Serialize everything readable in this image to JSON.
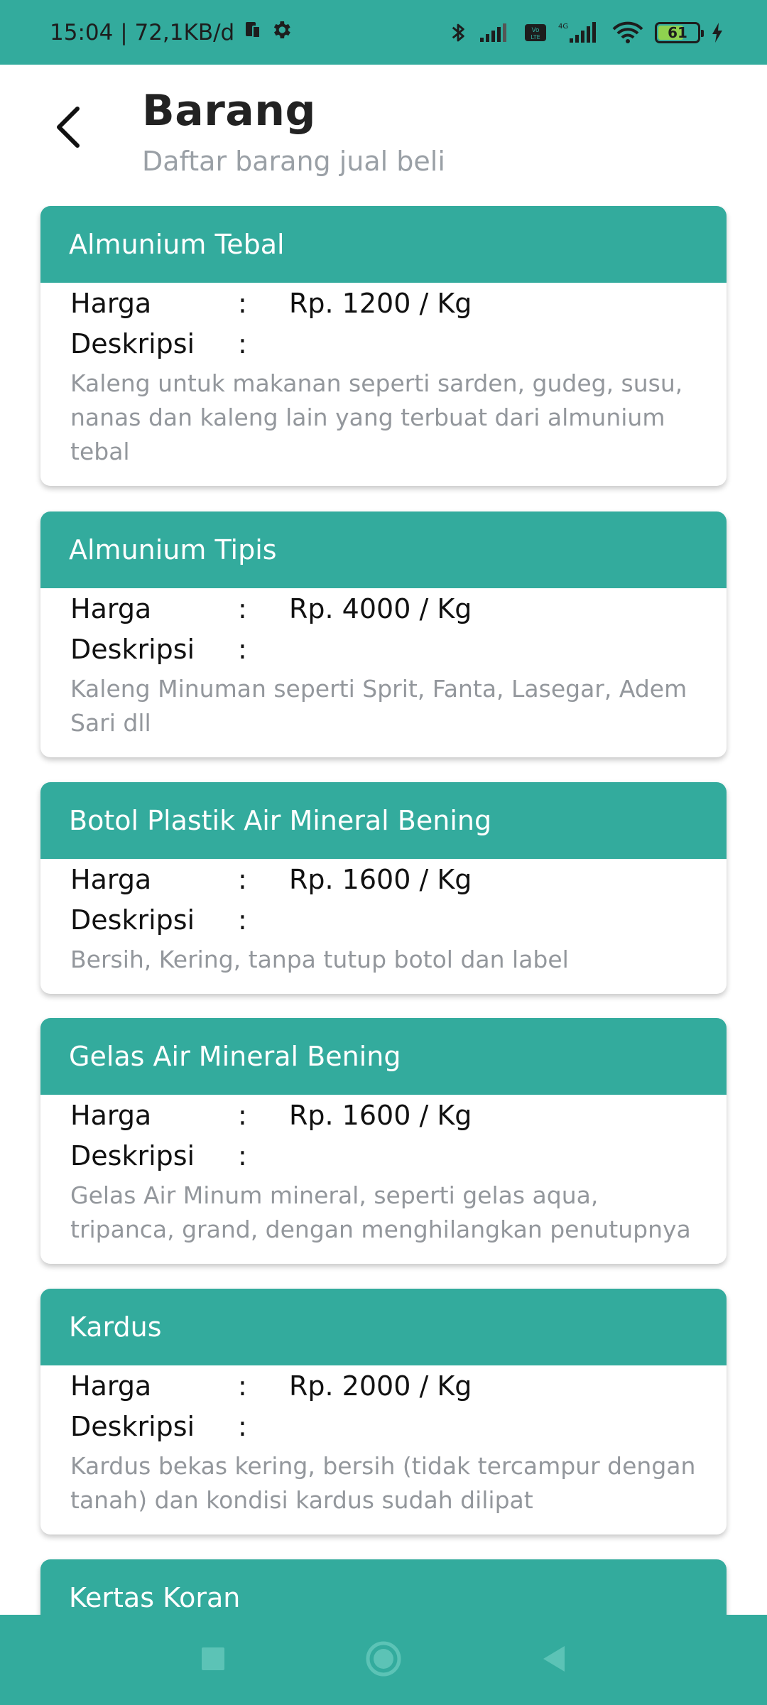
{
  "status_bar": {
    "time_speed": "15:04 | 72,1KB/d",
    "battery_level": "61"
  },
  "header": {
    "title": "Barang",
    "subtitle": "Daftar barang jual beli"
  },
  "items": [
    {
      "name": "Almunium Tebal",
      "price_label": "Harga",
      "colon": ":",
      "price": "Rp. 1200 / Kg",
      "desc_label": "Deskripsi",
      "description": "Kaleng untuk makanan seperti sarden, gudeg,  susu, nanas dan kaleng lain yang terbuat dari almunium tebal"
    },
    {
      "name": "Almunium Tipis",
      "price_label": "Harga",
      "colon": ":",
      "price": "Rp. 4000 / Kg",
      "desc_label": "Deskripsi",
      "description": "Kaleng Minuman seperti Sprit, Fanta, Lasegar, Adem Sari dll"
    },
    {
      "name": "Botol Plastik Air Mineral Bening",
      "price_label": "Harga",
      "colon": ":",
      "price": "Rp. 1600 / Kg",
      "desc_label": "Deskripsi",
      "description": "Bersih, Kering, tanpa tutup botol dan label"
    },
    {
      "name": "Gelas Air Mineral Bening",
      "price_label": "Harga",
      "colon": ":",
      "price": "Rp. 1600 / Kg",
      "desc_label": "Deskripsi",
      "description": "Gelas Air Minum mineral, seperti gelas aqua, tripanca, grand, dengan menghilangkan penutupnya"
    },
    {
      "name": "Kardus",
      "price_label": "Harga",
      "colon": ":",
      "price": "Rp. 2000 / Kg",
      "desc_label": "Deskripsi",
      "description": "Kardus bekas kering, bersih (tidak tercampur dengan tanah) dan kondisi kardus sudah dilipat"
    },
    {
      "name": "Kertas Koran"
    }
  ],
  "icons": {
    "back": "arrow-back-icon",
    "nav_recents": "square-icon",
    "nav_home": "circle-icon",
    "nav_back": "triangle-back-icon"
  },
  "colors": {
    "accent": "#33ab9d",
    "title_text": "#222222",
    "muted_text": "#93979c"
  }
}
